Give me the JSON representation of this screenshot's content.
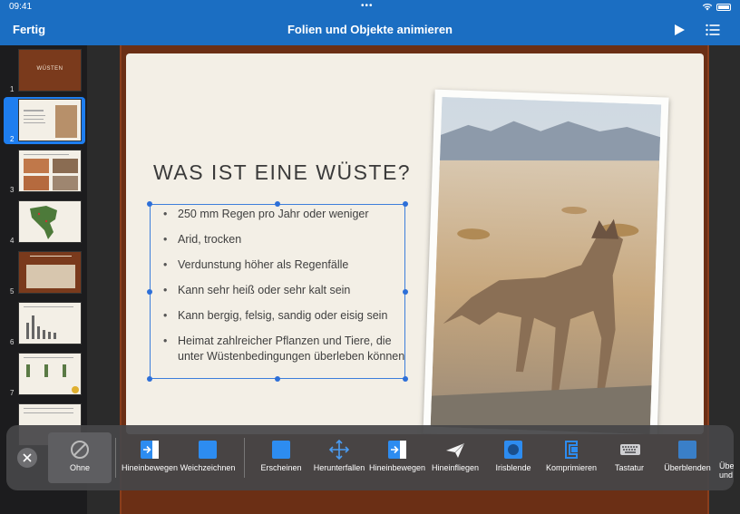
{
  "status": {
    "time": "09:41"
  },
  "nav": {
    "done_label": "Fertig",
    "title": "Folien und Objekte animieren"
  },
  "sidebar": {
    "slides": [
      {
        "number": "1",
        "thumb_title": "WÜSTEN"
      },
      {
        "number": "2"
      },
      {
        "number": "3"
      },
      {
        "number": "4"
      },
      {
        "number": "5"
      },
      {
        "number": "6"
      },
      {
        "number": "7"
      }
    ]
  },
  "slide": {
    "title": "WAS IST EINE WÜSTE?",
    "bullets": [
      "250 mm Regen pro Jahr oder weniger",
      "Arid, trocken",
      "Verdunstung höher als Regenfälle",
      "Kann sehr heiß oder sehr kalt sein",
      "Kann bergig, felsig, sandig oder eisig sein",
      "Heimat zahlreicher Pflanzen und Tiere, die unter Wüstenbedingungen überleben können"
    ]
  },
  "animations": {
    "none_label": "Ohne",
    "options": [
      "Hineinbewegen",
      "Weichzeichnen",
      "Erscheinen",
      "Herunterfallen",
      "Hineinbewegen",
      "Hineinfliegen",
      "Irisblende",
      "Komprimieren",
      "Tastatur",
      "Überblenden",
      "Über und"
    ]
  },
  "colors": {
    "accent": "#1b6ec2",
    "selection": "#1e7ef0",
    "frame": "#6b2f15"
  }
}
